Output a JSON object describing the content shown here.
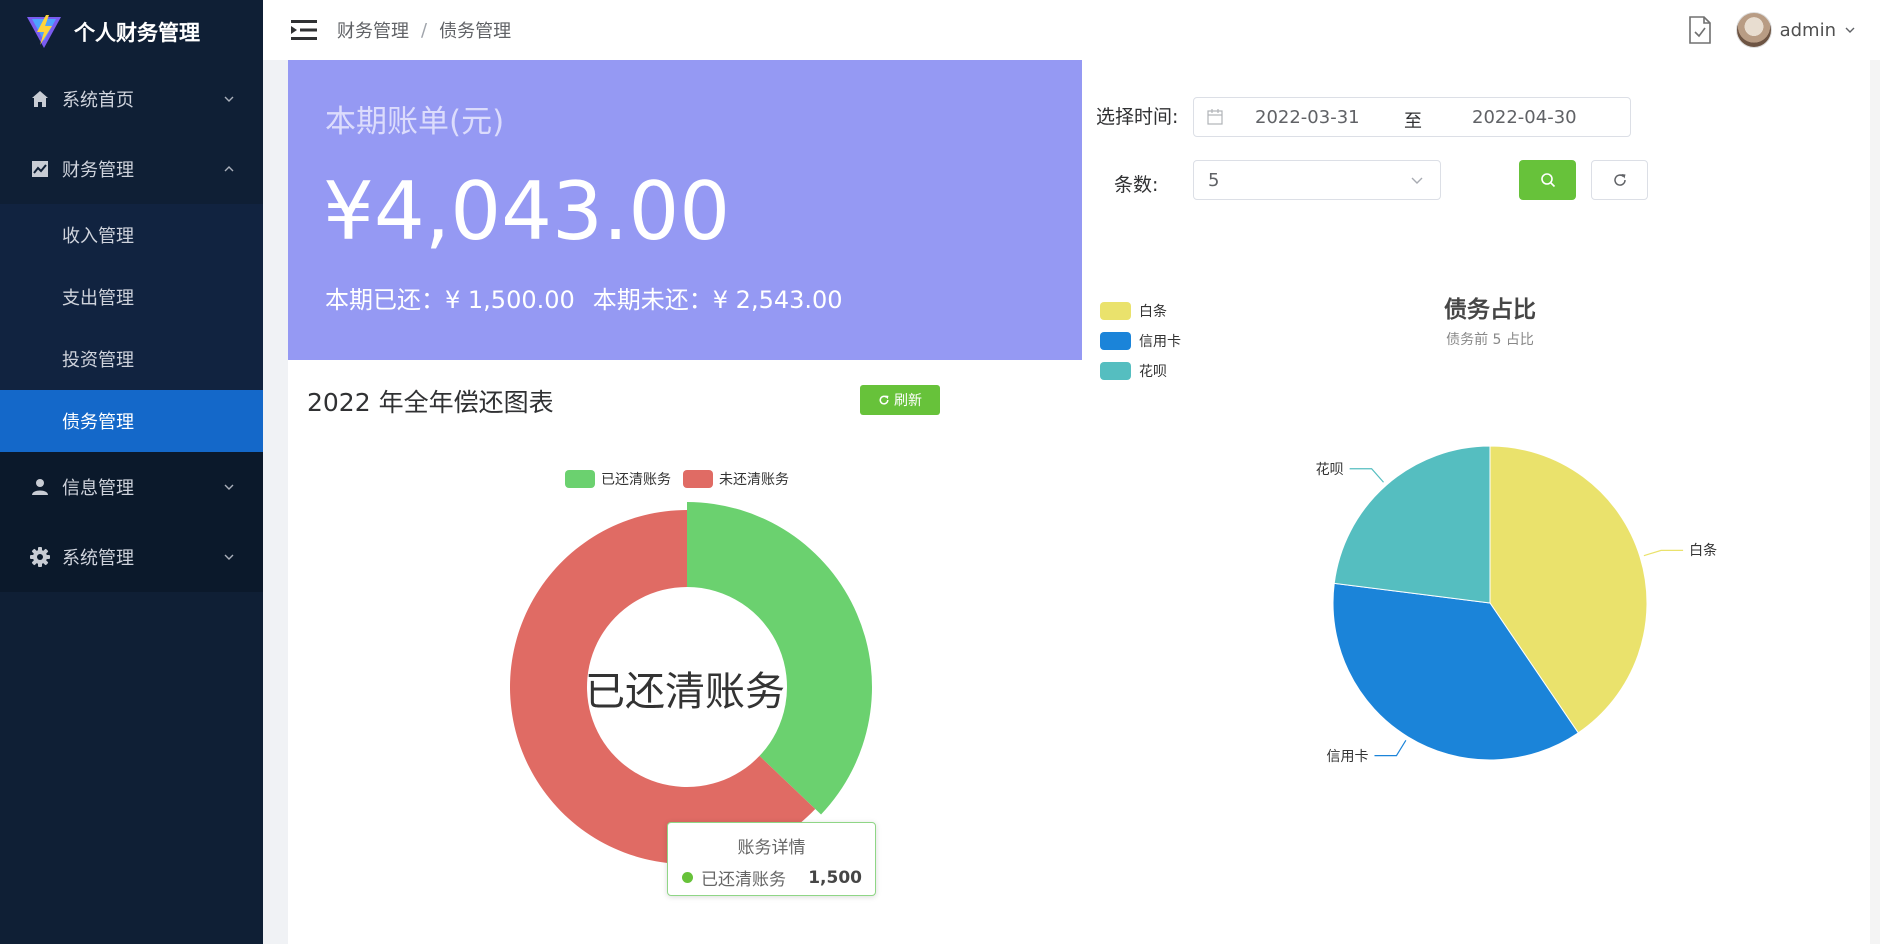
{
  "app": {
    "title": "个人财务管理"
  },
  "sidebar": {
    "items": [
      {
        "label": "系统首页",
        "icon": "home-icon",
        "expanded": false
      },
      {
        "label": "财务管理",
        "icon": "chart-icon",
        "expanded": true,
        "children": [
          {
            "label": "收入管理"
          },
          {
            "label": "支出管理"
          },
          {
            "label": "投资管理"
          },
          {
            "label": "债务管理",
            "active": true
          }
        ]
      },
      {
        "label": "信息管理",
        "icon": "user-icon",
        "expanded": false
      },
      {
        "label": "系统管理",
        "icon": "gear-icon",
        "expanded": false
      }
    ]
  },
  "header": {
    "breadcrumb": [
      "财务管理",
      "债务管理"
    ],
    "breadcrumb_sep": "/",
    "user": "admin"
  },
  "bill": {
    "title": "本期账单(元)",
    "amount": "¥4,043.00",
    "paid": "本期已还：¥ 1,500.00",
    "unpaid": "本期未还：¥ 2,543.00"
  },
  "filters": {
    "time_label": "选择时间:",
    "start_date": "2022-03-31",
    "range_sep": "至",
    "end_date": "2022-04-30",
    "count_label": "条数:",
    "count_value": "5"
  },
  "colors": {
    "green": "#67c23a",
    "red": "#e06b64",
    "yellow": "#eae26c",
    "blue": "#1b84d9",
    "teal": "#55bec0",
    "bill_bg": "#9599f3",
    "active_menu": "#1468c9"
  },
  "left_chart": {
    "title": "2022 年全年偿还图表",
    "refresh_label": "刷新",
    "center_label": "已还清账务",
    "tooltip": {
      "title": "账务详情",
      "series": "已还清账务",
      "value": "1,500"
    }
  },
  "right_chart": {
    "title": "债务占比",
    "subtitle": "债务前 5 占比"
  },
  "chart_data": [
    {
      "type": "pie",
      "variant": "donut",
      "title": "2022 年全年偿还图表",
      "legend": [
        "已还清账务",
        "未还清账务"
      ],
      "series": [
        {
          "name": "已还清账务",
          "value": 1500,
          "color": "#6bd16f"
        },
        {
          "name": "未还清账务",
          "value": 2543,
          "color": "#e06b64"
        }
      ],
      "highlighted": "已还清账务",
      "legend_position": "top"
    },
    {
      "type": "pie",
      "title": "债务占比",
      "subtitle": "债务前 5 占比",
      "legend": [
        "白条",
        "信用卡",
        "花呗"
      ],
      "series": [
        {
          "name": "白条",
          "value": 40.5,
          "color": "#eae26c"
        },
        {
          "name": "信用卡",
          "value": 36.5,
          "color": "#1b84d9"
        },
        {
          "name": "花呗",
          "value": 23,
          "color": "#55bec0"
        }
      ],
      "legend_position": "top-left"
    }
  ]
}
